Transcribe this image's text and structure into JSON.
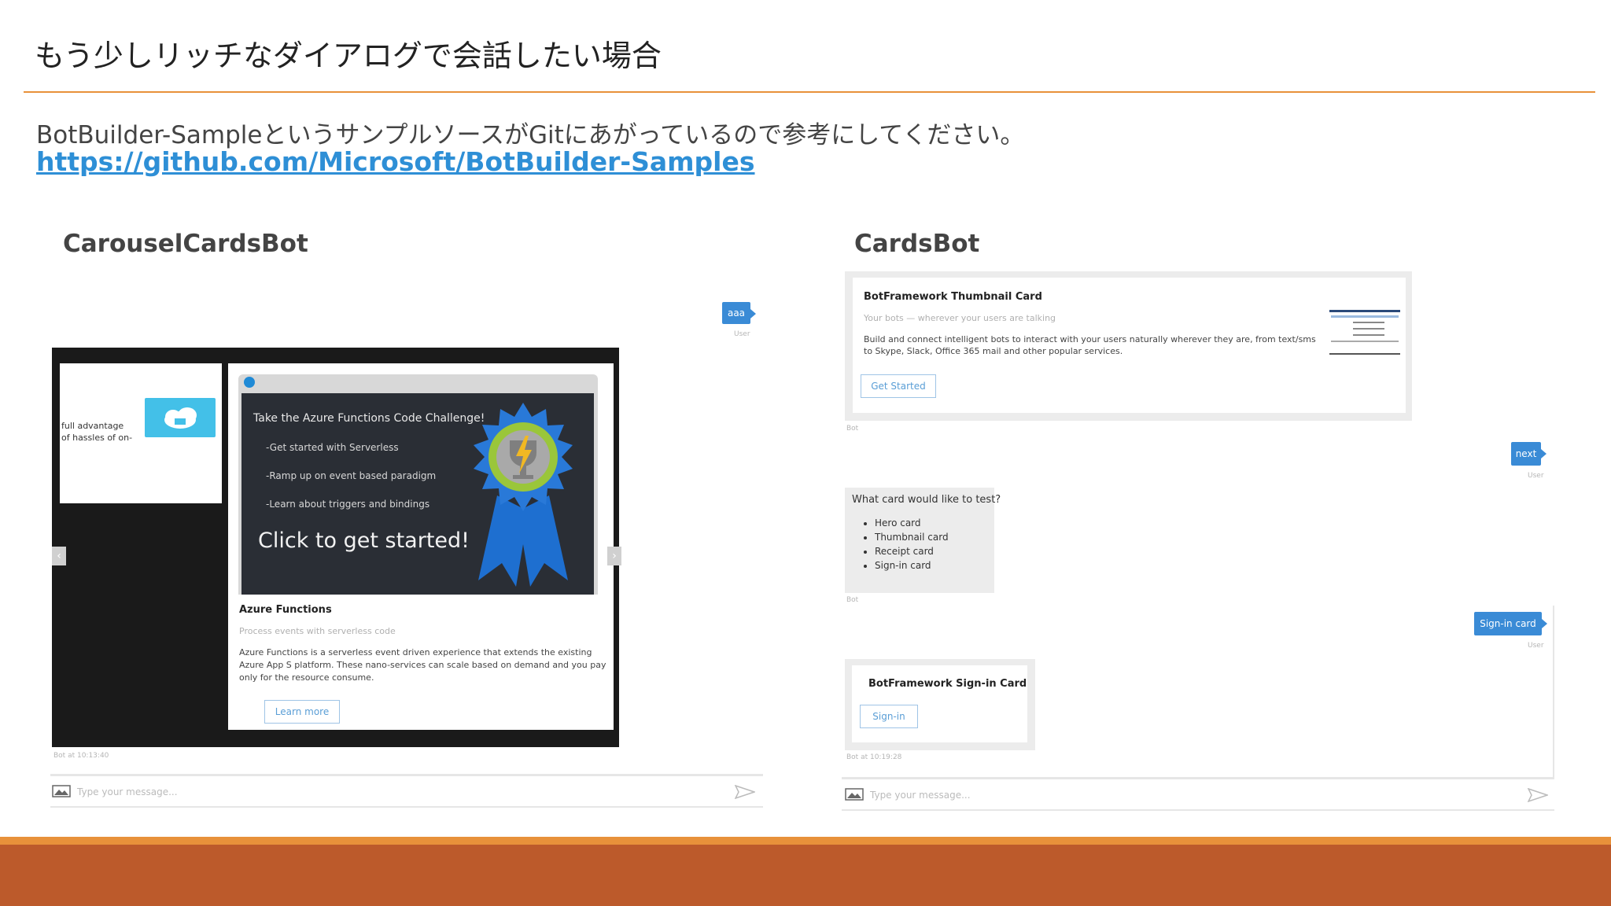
{
  "slide": {
    "title": "もう少しリッチなダイアログで会話したい場合",
    "intro": "BotBuilder-SampleというサンプルソースがGitにあがっているので参考にしてください。",
    "link": "https://github.com/Microsoft/BotBuilder-Samples"
  },
  "left_demo": {
    "label": "CarouselCardsBot",
    "user_message": "aaa",
    "user_caption": "User",
    "side_card_text": "full advantage of hassles of on-",
    "hero_heading": "Take the Azure Functions Code Challenge!",
    "hero_items": [
      "-Get started with Serverless",
      "-Ramp up on event based paradigm",
      "-Learn about triggers and bindings"
    ],
    "hero_cta": "Click to get started!",
    "card_title": "Azure Functions",
    "card_subtitle": "Process events with serverless code",
    "card_body": "Azure Functions is a serverless event driven experience that extends the existing Azure App S platform. These nano-services can scale based on demand and you pay only for the resource consume.",
    "card_button": "Learn more",
    "timestamp": "Bot at 10:13:40",
    "compose_placeholder": "Type your message...",
    "icons": {
      "prev": "chevron-left-icon",
      "next": "chevron-right-icon",
      "image": "image-upload-icon",
      "send": "send-icon"
    }
  },
  "right_demo": {
    "label": "CardsBot",
    "thumbnail_card": {
      "title": "BotFramework Thumbnail Card",
      "subtitle": "Your bots — wherever your users are talking",
      "body": "Build and connect intelligent bots to interact with your users naturally wherever they are, from text/sms to Skype, Slack, Office 365 mail and other popular services.",
      "button": "Get Started"
    },
    "bot_caption": "Bot",
    "user_next": "next",
    "user_caption": "User",
    "question": "What card would like to test?",
    "options": [
      "Hero card",
      "Thumbnail card",
      "Receipt card",
      "Sign-in card"
    ],
    "user_signin": "Sign-in card",
    "signin_card": {
      "title": "BotFramework Sign-in Card",
      "button": "Sign-in"
    },
    "timestamp": "Bot at 10:19:28",
    "compose_placeholder": "Type your message..."
  },
  "colors": {
    "accent": "#e8913a",
    "footer": "#bc5a2b",
    "link": "#2e8fd6",
    "bubble": "#3a8bd6"
  }
}
